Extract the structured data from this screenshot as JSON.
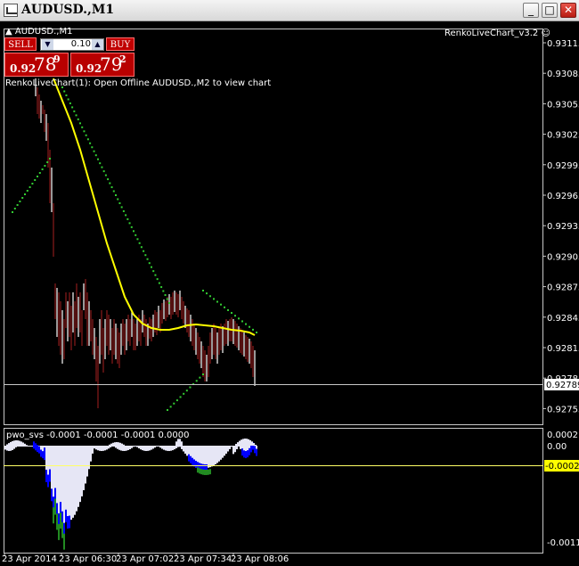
{
  "window": {
    "title": "AUDUSD.,M1",
    "minimize": "_",
    "maximize": "□",
    "close": "✕"
  },
  "chart": {
    "symbol_label": "AUDUSD.,M1",
    "indicator_label": "RenkoLiveChart_v3.2",
    "status_message": "RenkoLiveChart(1): Open Offline AUDUSD.,M2 to view chart",
    "current_price": "0.92789",
    "price_axis": [
      "0.93115",
      "0.93085",
      "0.93055",
      "0.93025",
      "0.92995",
      "0.92965",
      "0.92935",
      "0.92905",
      "0.92875",
      "0.92845",
      "0.92815",
      "0.92785",
      "0.92755"
    ],
    "time_axis": [
      "23 Apr 2014",
      "23 Apr 06:30",
      "23 Apr 07:02",
      "23 Apr 07:34",
      "23 Apr 08:06"
    ]
  },
  "trade_panel": {
    "sell_label": "SELL",
    "buy_label": "BUY",
    "lot_value": "0.10",
    "sell_quote": {
      "main": "0.92",
      "big": "78",
      "sup": "9"
    },
    "buy_quote": {
      "main": "0.92",
      "big": "79",
      "sup": "2"
    }
  },
  "subwindow": {
    "indicator_label": "pwo_svs -0.0001 -0.0001 -0.0001 0.0000",
    "axis_labels": [
      "0.0002",
      "0.00",
      "-0.0011"
    ],
    "current_value": "-0.00021"
  },
  "colors": {
    "bull_candle": "#8b1a1a",
    "bear_candle": "#ffffff",
    "ma_line": "#ffff00",
    "sar_dots": "#32cd32",
    "osc_fill": "#e6e6f5",
    "osc_blue": "#0000ff",
    "osc_red": "#ff0000",
    "osc_green": "#228b22"
  }
}
